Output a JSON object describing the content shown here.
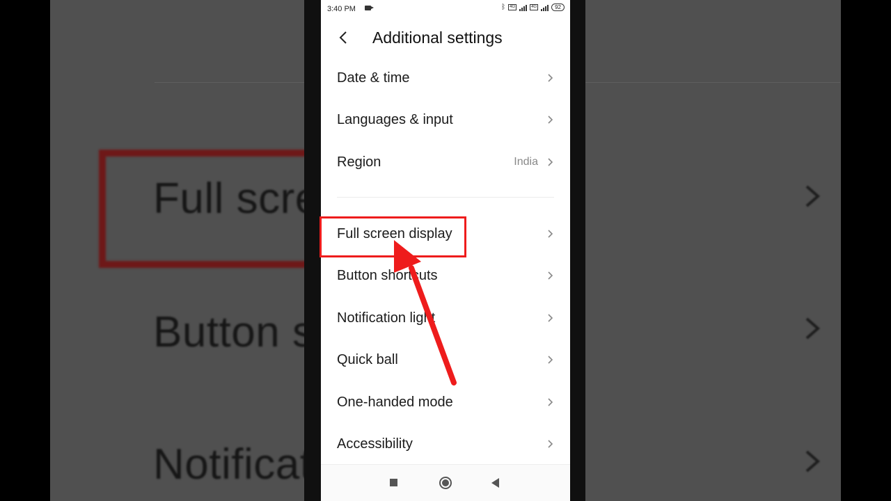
{
  "status_bar": {
    "time": "3:40 PM",
    "battery": "92",
    "volte": "Vo LTE"
  },
  "header": {
    "title": "Additional settings"
  },
  "settings_group_1": [
    {
      "label": "Date & time"
    },
    {
      "label": "Languages & input"
    },
    {
      "label": "Region",
      "value": "India"
    }
  ],
  "settings_group_2": [
    {
      "label": "Full screen display"
    },
    {
      "label": "Button shortcuts"
    },
    {
      "label": "Notification light"
    },
    {
      "label": "Quick ball"
    },
    {
      "label": "One-handed mode"
    },
    {
      "label": "Accessibility"
    }
  ],
  "background": {
    "text_1": "Full screer",
    "text_2": "Button sho",
    "text_3": "Notificatio"
  },
  "annotation": {
    "color": "#ee1c1c"
  },
  "icons": [
    "back-arrow-icon",
    "chevron-right-icon",
    "bluetooth-icon",
    "video-camera-icon",
    "signal-icon",
    "battery-icon",
    "recents-icon",
    "home-icon",
    "back-icon"
  ]
}
